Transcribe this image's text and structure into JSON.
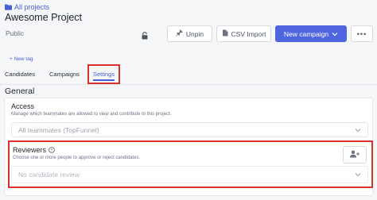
{
  "breadcrumb": {
    "label": "All projects"
  },
  "project": {
    "title": "Awesome Project",
    "visibility": "Public"
  },
  "toolbar": {
    "unpin_label": "Unpin",
    "csv_import_label": "CSV Import",
    "new_campaign_label": "New campaign",
    "more_label": "•••"
  },
  "tags": {
    "new_tag_label": "+ New tag"
  },
  "tabs": [
    {
      "label": "Candidates"
    },
    {
      "label": "Campaigns"
    },
    {
      "label": "Settings",
      "active": true
    }
  ],
  "general": {
    "heading": "General",
    "access": {
      "title": "Access",
      "description": "Manage which teammates are allowed to view and contribute to this project.",
      "selected": "All teammates (TopFunnel)"
    },
    "reviewers": {
      "title": "Reviewers",
      "description": "Choose one or more people to approve or reject candidates.",
      "placeholder": "No candidate review"
    }
  },
  "colors": {
    "accent": "#4f66e0",
    "highlight_box": "#d7332a",
    "background": "#f5f6f8"
  }
}
